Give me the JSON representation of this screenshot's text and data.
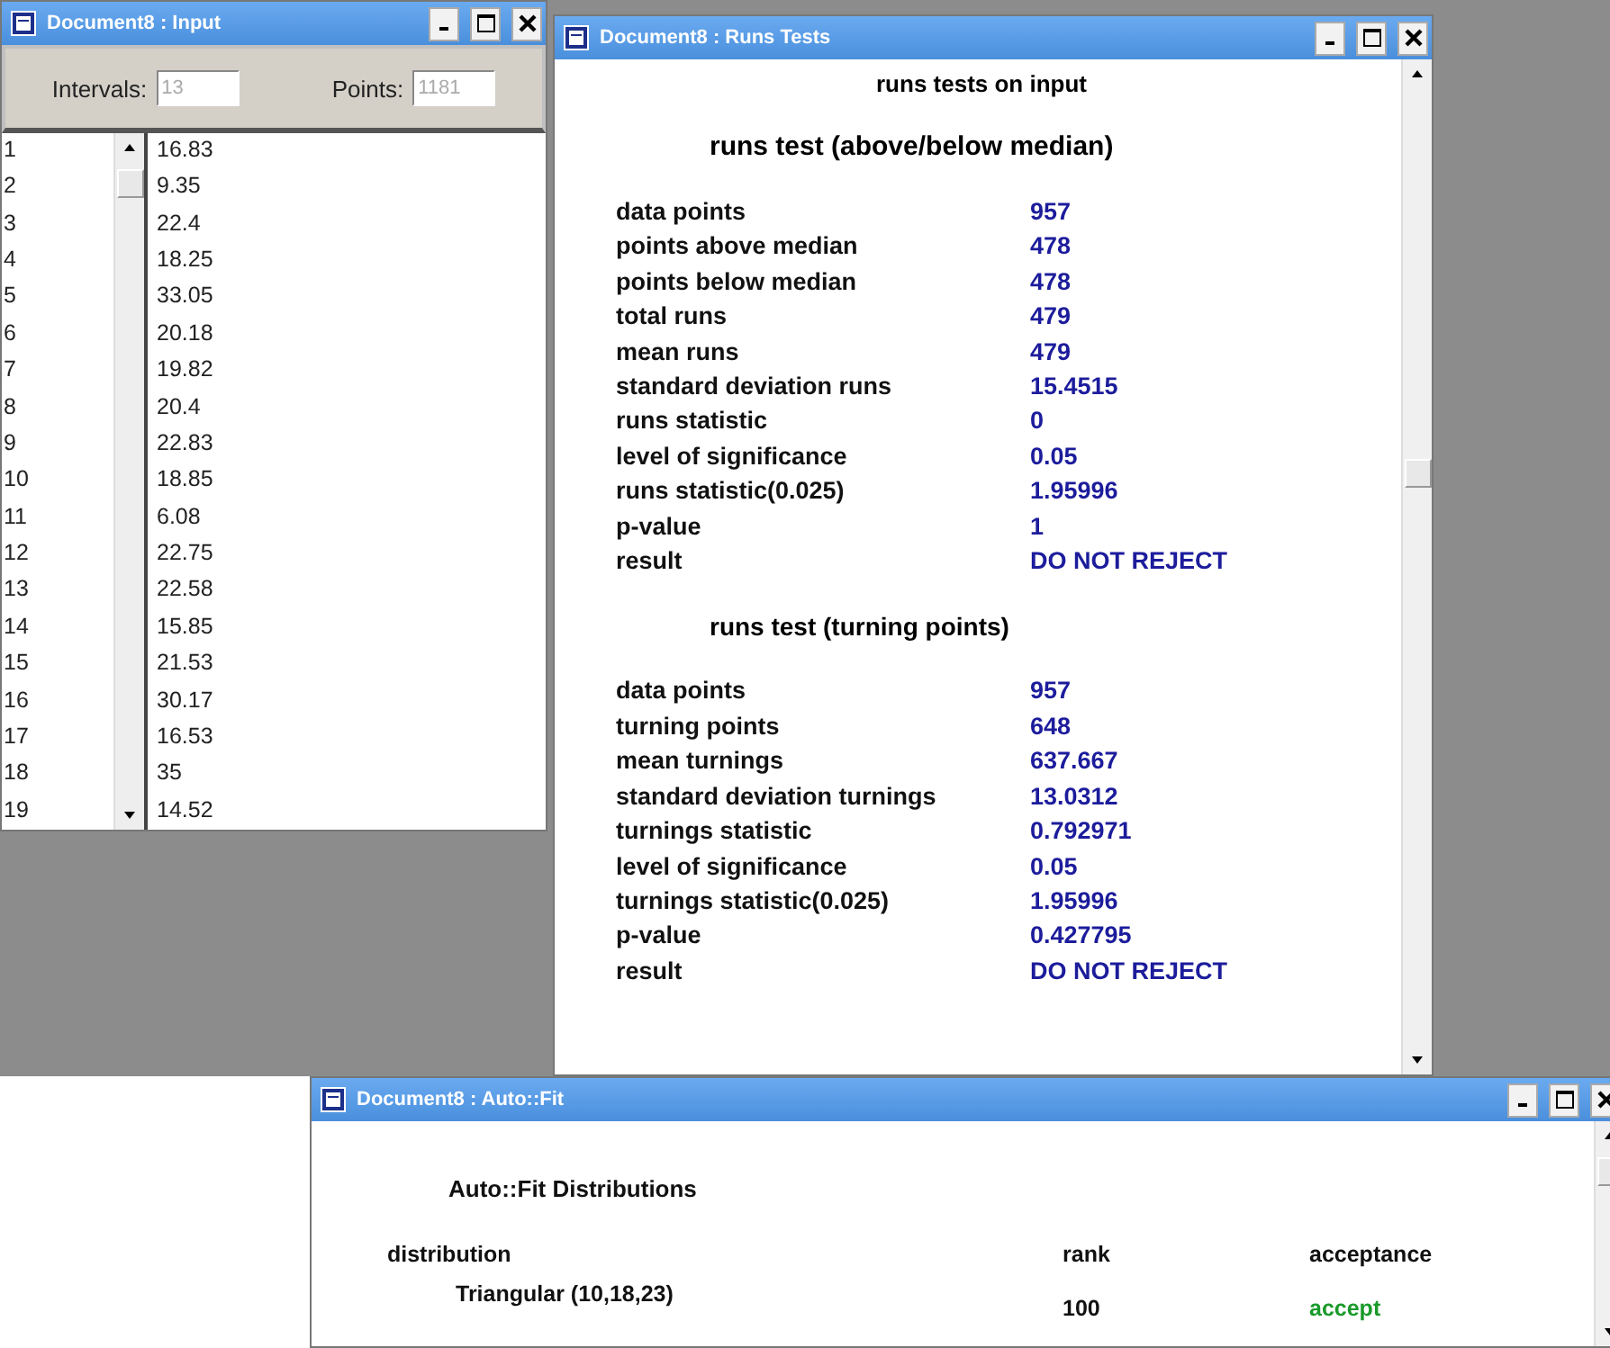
{
  "input_window": {
    "title": "Document8 : Input",
    "intervals": {
      "label": "Intervals:",
      "value": "13",
      "disabled": true
    },
    "points": {
      "label": "Points:",
      "value": "1181",
      "disabled": true
    },
    "rows": [
      {
        "index": "1",
        "value": "16.83"
      },
      {
        "index": "2",
        "value": "9.35"
      },
      {
        "index": "3",
        "value": "22.4"
      },
      {
        "index": "4",
        "value": "18.25"
      },
      {
        "index": "5",
        "value": "33.05"
      },
      {
        "index": "6",
        "value": "20.18"
      },
      {
        "index": "7",
        "value": "19.82"
      },
      {
        "index": "8",
        "value": "20.4"
      },
      {
        "index": "9",
        "value": "22.83"
      },
      {
        "index": "10",
        "value": "18.85"
      },
      {
        "index": "11",
        "value": "6.08"
      },
      {
        "index": "12",
        "value": "22.75"
      },
      {
        "index": "13",
        "value": "22.58"
      },
      {
        "index": "14",
        "value": "15.85"
      },
      {
        "index": "15",
        "value": "21.53"
      },
      {
        "index": "16",
        "value": "30.17"
      },
      {
        "index": "17",
        "value": "16.53"
      },
      {
        "index": "18",
        "value": "35"
      },
      {
        "index": "19",
        "value": "14.52"
      }
    ]
  },
  "runs_window": {
    "title": "Document8 : Runs Tests",
    "heading": "runs tests on input",
    "sections": [
      {
        "title": "runs test (above/below median)",
        "rows": [
          {
            "label": "data points",
            "value": "957"
          },
          {
            "label": "points above median",
            "value": "478"
          },
          {
            "label": "points below median",
            "value": "478"
          },
          {
            "label": "total runs",
            "value": "479"
          },
          {
            "label": "mean runs",
            "value": "479"
          },
          {
            "label": "standard deviation runs",
            "value": "15.4515"
          },
          {
            "label": "runs statistic",
            "value": "0"
          },
          {
            "label": "level of significance",
            "value": "0.05"
          },
          {
            "label": "runs statistic(0.025)",
            "value": "1.95996"
          },
          {
            "label": "p-value",
            "value": "1"
          },
          {
            "label": "result",
            "value": "DO NOT REJECT"
          }
        ]
      },
      {
        "title": "runs test (turning points)",
        "rows": [
          {
            "label": "data points",
            "value": "957"
          },
          {
            "label": "turning points",
            "value": "648"
          },
          {
            "label": "mean turnings",
            "value": "637.667"
          },
          {
            "label": "standard deviation turnings",
            "value": "13.0312"
          },
          {
            "label": "turnings statistic",
            "value": "0.792971"
          },
          {
            "label": "level of significance",
            "value": "0.05"
          },
          {
            "label": "turnings statistic(0.025)",
            "value": "1.95996"
          },
          {
            "label": "p-value",
            "value": "0.427795"
          },
          {
            "label": "result",
            "value": "DO NOT REJECT"
          }
        ]
      }
    ]
  },
  "autofit_window": {
    "title": "Document8 : Auto::Fit",
    "heading": "Auto::Fit Distributions",
    "columns": [
      "distribution",
      "rank",
      "acceptance"
    ],
    "rows": [
      {
        "distribution": "Triangular (10,18,23)",
        "rank": "100",
        "acceptance": "accept",
        "accepted": true
      }
    ]
  }
}
